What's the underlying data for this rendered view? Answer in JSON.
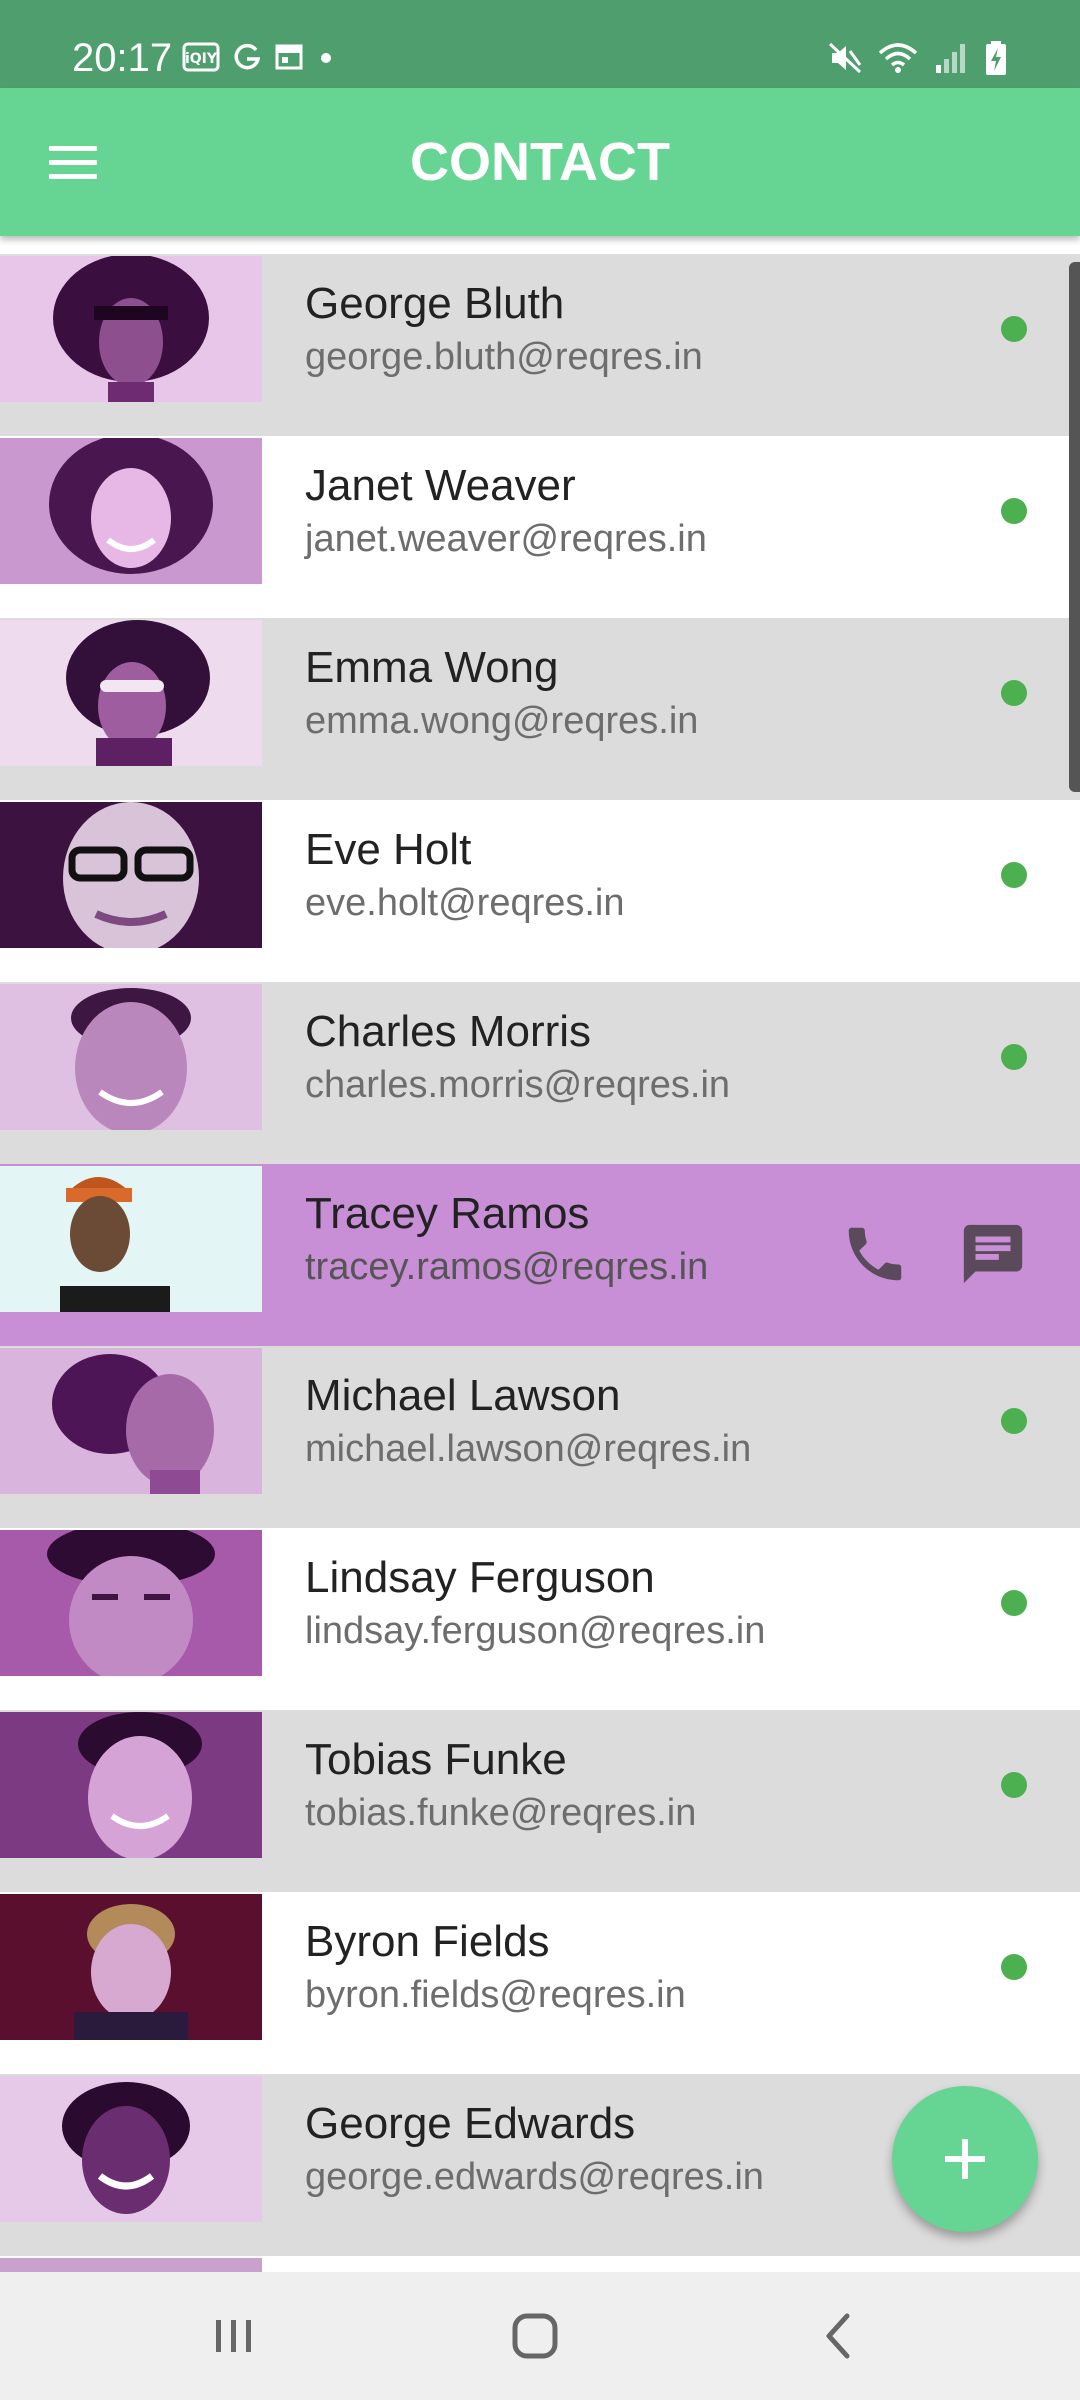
{
  "status_bar": {
    "time": "20:17",
    "left_icons": [
      "iqiyi-icon",
      "g-icon",
      "calendar-icon",
      "dot-icon"
    ],
    "right_icons": [
      "mute-icon",
      "wifi-icon",
      "signal-icon",
      "battery-charging-icon"
    ]
  },
  "appbar": {
    "title": "CONTACT",
    "menu_icon": "hamburger-menu-icon"
  },
  "contacts": [
    {
      "name": "George Bluth",
      "email": "george.bluth@reqres.in",
      "online": true
    },
    {
      "name": "Janet Weaver",
      "email": "janet.weaver@reqres.in",
      "online": true
    },
    {
      "name": "Emma Wong",
      "email": "emma.wong@reqres.in",
      "online": true
    },
    {
      "name": "Eve Holt",
      "email": "eve.holt@reqres.in",
      "online": true
    },
    {
      "name": "Charles Morris",
      "email": "charles.morris@reqres.in",
      "online": true
    },
    {
      "name": "Tracey Ramos",
      "email": "tracey.ramos@reqres.in",
      "selected": true,
      "actions": [
        "phone-icon",
        "message-icon"
      ]
    },
    {
      "name": "Michael Lawson",
      "email": "michael.lawson@reqres.in",
      "online": true
    },
    {
      "name": "Lindsay Ferguson",
      "email": "lindsay.ferguson@reqres.in",
      "online": true
    },
    {
      "name": "Tobias Funke",
      "email": "tobias.funke@reqres.in",
      "online": true
    },
    {
      "name": "Byron Fields",
      "email": "byron.fields@reqres.in",
      "online": true
    },
    {
      "name": "George Edwards",
      "email": "george.edwards@reqres.in",
      "online": false
    }
  ],
  "fab": {
    "icon": "plus-icon"
  },
  "nav_bar": {
    "buttons": [
      "recent-apps-icon",
      "home-icon",
      "back-icon"
    ]
  },
  "colors": {
    "status_bar": "#4f9e6e",
    "app_bar": "#66d492",
    "row_gray": "#dcdcdc",
    "row_selected": "#c88ed6",
    "online_dot": "#4caf50",
    "avatar_tint": "#7a2a86"
  }
}
